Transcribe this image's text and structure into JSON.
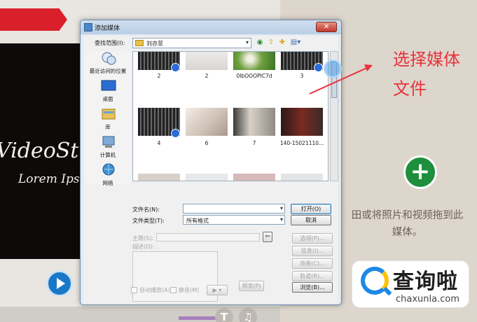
{
  "background": {
    "preview_title": "VideoStu",
    "preview_subtitle": "Lorem Ipsu",
    "annotation_line1": "选择媒体",
    "annotation_line2": "文件",
    "drop_hint_line1": "田或将照片和视频拖到此",
    "drop_hint_line2": "媒体。",
    "annotation_color": "#e8323d",
    "accent_red": "#d9202a",
    "plus_green": "#1e8f3c"
  },
  "watermark": {
    "name": "查询啦",
    "domain": "chaxunla.com"
  },
  "dialog": {
    "title": "添加媒体",
    "look_in_label": "查找范围(I):",
    "current_folder": "刘亦菲",
    "places": [
      {
        "label": "最近访问的位置",
        "icon": "recent-places-icon"
      },
      {
        "label": "桌面",
        "icon": "desktop-icon"
      },
      {
        "label": "库",
        "icon": "library-icon"
      },
      {
        "label": "计算机",
        "icon": "computer-icon"
      },
      {
        "label": "网络",
        "icon": "network-icon"
      }
    ],
    "files": [
      {
        "name": "2",
        "kind": "video"
      },
      {
        "name": "2",
        "kind": "image"
      },
      {
        "name": "0IbOOOPIC7d",
        "kind": "image"
      },
      {
        "name": "3",
        "kind": "video"
      },
      {
        "name": "4",
        "kind": "video"
      },
      {
        "name": "6",
        "kind": "image"
      },
      {
        "name": "7",
        "kind": "image"
      },
      {
        "name": "140-15021110...",
        "kind": "image"
      }
    ],
    "filename_label": "文件名(N):",
    "filename_value": "",
    "filetype_label": "文件类型(T):",
    "filetype_value": "所有格式",
    "open_button": "打开(O)",
    "cancel_button": "取消",
    "subject_label": "主题(S):",
    "description_label": "描述(D):",
    "options_button": "选项(P)...",
    "info_button": "信息(I)...",
    "scene_button": "场景(C)...",
    "tracks_button": "轨道(R)...",
    "browse_button": "浏览(B)...",
    "autoplay_label": "自动播放(A)",
    "mute_label": "静音(M)",
    "preview_button": "预览(P)"
  }
}
